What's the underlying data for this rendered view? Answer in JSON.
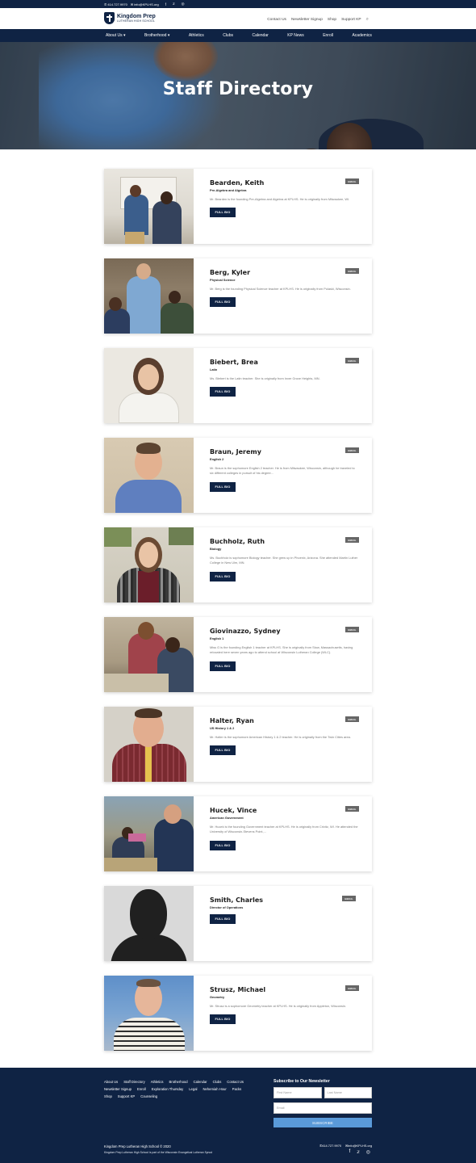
{
  "topbar": {
    "phone": "414.727.9970",
    "email": "info@KPLHS.org",
    "social_icons": [
      "facebook-icon",
      "twitter-icon",
      "instagram-icon"
    ]
  },
  "header": {
    "logo_title": "Kingdom Prep",
    "logo_subtitle": "LUTHERAN HIGH SCHOOL",
    "links": [
      "Contact Us",
      "Newsletter Signup",
      "Shop",
      "Support KP"
    ],
    "search_icon": "⌕"
  },
  "nav": {
    "items": [
      "About Us ▾",
      "Brotherhood ▾",
      "Athletics",
      "Clubs",
      "Calendar",
      "KP News",
      "Enroll",
      "Academics"
    ]
  },
  "hero": {
    "title": "Staff Directory"
  },
  "staff": [
    {
      "name": "Bearden, Keith",
      "subject": "Pre-Algebra and Algebra",
      "desc": "Mr. Bearden is the founding Pre-Algebra and Algebra at KPLHS. He is originally from Milwaukee, WI.",
      "email_label": "EMAIL",
      "bio_label": "FULL BIO"
    },
    {
      "name": "Berg, Kyler",
      "subject": "Physical Science",
      "desc": "Mr. Berg is the founding Physical Science teacher at KPLHS. He is originally from Pulaski, Wisconsin.",
      "email_label": "EMAIL",
      "bio_label": "FULL BIO"
    },
    {
      "name": "Biebert, Brea",
      "subject": "Latin",
      "desc": "Ms. Biebert is the Latin teacher. She is originally from Inver Grove Heights, MN.",
      "email_label": "EMAIL",
      "bio_label": "FULL BIO"
    },
    {
      "name": "Braun, Jeremy",
      "subject": "English 2",
      "desc": "Mr. Braun is the sophomore English 2 teacher. He is from Milwaukee, Wisconsin, although he traveled to six different colleges in pursuit of his degree…",
      "email_label": "EMAIL",
      "bio_label": "FULL BIO"
    },
    {
      "name": "Buchholz, Ruth",
      "subject": "Biology",
      "desc": "Ms. Buchholz is sophomore Biology teacher. She grew up in Phoenix, Arizona. She attended Martin Luther College in New Ulm, MN.",
      "email_label": "EMAIL",
      "bio_label": "FULL BIO"
    },
    {
      "name": "Giovinazzo, Sydney",
      "subject": "English 1",
      "desc": "Miss G is the founding English 1 teacher at KPLHS. She is originally from Stow, Massachusetts, having relocated here seven years ago to attend school at Wisconsin Lutheran College (WLC).",
      "email_label": "EMAIL",
      "bio_label": "FULL BIO"
    },
    {
      "name": "Halter, Ryan",
      "subject": "US History 1 & 2",
      "desc": "Mr. Halter is the sophomore American History 1 & 2 teacher. He is originally from the Twin Cities area.",
      "email_label": "EMAIL",
      "bio_label": "FULL BIO"
    },
    {
      "name": "Hucek, Vince",
      "subject": "American Government",
      "desc": "Mr. Hucek is the founding Government teacher at KPLHS. He is originally from Crivitz, WI. He attended the University of Wisconsin-Stevens Point,…",
      "email_label": "EMAIL",
      "bio_label": "FULL BIO"
    },
    {
      "name": "Smith, Charles",
      "subject": "Director of Operations",
      "desc": "",
      "email_label": "EMAIL",
      "bio_label": "FULL BIO"
    },
    {
      "name": "Strusz, Michael",
      "subject": "Geometry",
      "desc": "Mr. Strusz is a sophomore Geometry teacher at KPLHS. He is originally from Appleton, Wisconsin.",
      "email_label": "EMAIL",
      "bio_label": "FULL BIO"
    }
  ],
  "footer": {
    "links": [
      "About Us",
      "Staff Directory",
      "Athletics",
      "Brotherhood",
      "Calendar",
      "Clubs",
      "Contact Us",
      "Newsletter Signup",
      "Enroll",
      "Exploration Thursday",
      "Legal",
      "Nehemiah Hour",
      "Packs",
      "Shop",
      "Support KP",
      "Counseling"
    ],
    "newsletter_title": "Subscribe to Our Newsletter",
    "first_name_placeholder": "First Name",
    "last_name_placeholder": "Last Name",
    "email_placeholder": "Email",
    "subscribe_label": "SUBSCRIBE",
    "copyright": "Kingdom Prep Lutheran High School © 2020",
    "synod_note": "Kingdom Prep Lutheran High School is part of the Wisconsin Evangelical Lutheran Synod",
    "phone": "414.727.9970",
    "email": "info@KPLHS.org",
    "social_icons": [
      "facebook-icon",
      "twitter-icon",
      "instagram-icon"
    ]
  },
  "colors": {
    "navy": "#0f2344",
    "subscribe_blue": "#5a9ad9",
    "email_badge": "#666666"
  }
}
